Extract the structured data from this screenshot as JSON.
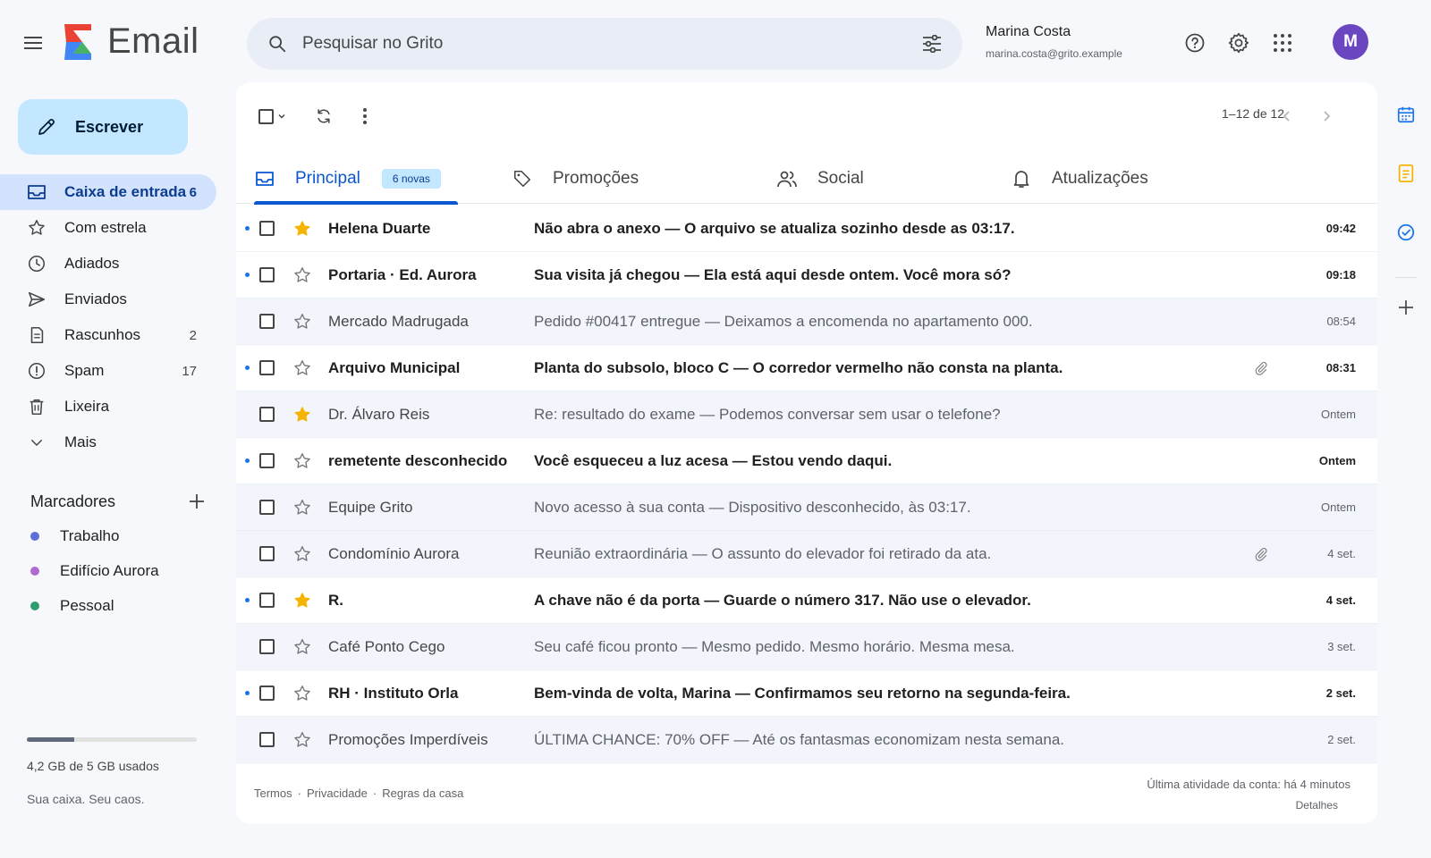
{
  "app": {
    "logo_text": "Email"
  },
  "search": {
    "placeholder": "Pesquisar no Grito"
  },
  "account": {
    "name": "Marina Costa",
    "email": "marina.costa@grito.example",
    "avatar_letter": "M",
    "avatar_color": "#6b46c1"
  },
  "compose": {
    "label": "Escrever"
  },
  "nav": [
    {
      "label": "Caixa de entrada",
      "count": "6",
      "icon": "inbox-icon",
      "active": true
    },
    {
      "label": "Com estrela",
      "count": "",
      "icon": "star-icon"
    },
    {
      "label": "Adiados",
      "count": "",
      "icon": "clock-icon"
    },
    {
      "label": "Enviados",
      "count": "",
      "icon": "send-icon"
    },
    {
      "label": "Rascunhos",
      "count": "2",
      "icon": "draft-icon"
    },
    {
      "label": "Spam",
      "count": "17",
      "icon": "spam-icon"
    },
    {
      "label": "Lixeira",
      "count": "",
      "icon": "trash-icon"
    },
    {
      "label": "Mais",
      "count": "",
      "icon": "chevron-down-icon"
    }
  ],
  "labels": {
    "title": "Marcadores",
    "items": [
      {
        "name": "Trabalho",
        "color": "#5b6fd6"
      },
      {
        "name": "Edifício Aurora",
        "color": "#b06ad0"
      },
      {
        "name": "Pessoal",
        "color": "#2e9e6e"
      }
    ]
  },
  "storage": {
    "text": "4,2 GB de 5 GB usados",
    "fraction": 0.28
  },
  "tagline": "Sua caixa. Seu caos.",
  "toolbar": {
    "pager": "1–12 de 12"
  },
  "tabs": [
    {
      "label": "Principal",
      "badge": "6 novas",
      "icon": "inbox-icon",
      "active": true
    },
    {
      "label": "Promoções",
      "icon": "tag-icon"
    },
    {
      "label": "Social",
      "icon": "people-icon"
    },
    {
      "label": "Atualizações",
      "icon": "bell-icon"
    }
  ],
  "emails": [
    {
      "sender": "Helena Duarte",
      "subject": "Não abra o anexo — O arquivo se atualiza sozinho desde as 03:17.",
      "time": "09:42",
      "unread": true,
      "starred": true,
      "attachment": false
    },
    {
      "sender": "Portaria · Ed. Aurora",
      "subject": "Sua visita já chegou — Ela está aqui desde ontem. Você mora só?",
      "time": "09:18",
      "unread": true,
      "starred": false,
      "attachment": false
    },
    {
      "sender": "Mercado Madrugada",
      "subject": "Pedido #00417 entregue — Deixamos a encomenda no apartamento 000.",
      "time": "08:54",
      "unread": false,
      "starred": false,
      "attachment": false
    },
    {
      "sender": "Arquivo Municipal",
      "subject": "Planta do subsolo, bloco C — O corredor vermelho não consta na planta.",
      "time": "08:31",
      "unread": true,
      "starred": false,
      "attachment": true
    },
    {
      "sender": "Dr. Álvaro Reis",
      "subject": "Re: resultado do exame — Podemos conversar sem usar o telefone?",
      "time": "Ontem",
      "unread": false,
      "starred": true,
      "attachment": false
    },
    {
      "sender": "remetente desconhecido",
      "subject": "Você esqueceu a luz acesa — Estou vendo daqui.",
      "time": "Ontem",
      "unread": true,
      "starred": false,
      "attachment": false
    },
    {
      "sender": "Equipe Grito",
      "subject": "Novo acesso à sua conta — Dispositivo desconhecido, às 03:17.",
      "time": "Ontem",
      "unread": false,
      "starred": false,
      "attachment": false
    },
    {
      "sender": "Condomínio Aurora",
      "subject": "Reunião extraordinária — O assunto do elevador foi retirado da ata.",
      "time": "4 set.",
      "unread": false,
      "starred": false,
      "attachment": true
    },
    {
      "sender": "R.",
      "subject": "A chave não é da porta — Guarde o número 317. Não use o elevador.",
      "time": "4 set.",
      "unread": true,
      "starred": true,
      "attachment": false
    },
    {
      "sender": "Café Ponto Cego",
      "subject": "Seu café ficou pronto — Mesmo pedido. Mesmo horário. Mesma mesa.",
      "time": "3 set.",
      "unread": false,
      "starred": false,
      "attachment": false
    },
    {
      "sender": "RH · Instituto Orla",
      "subject": "Bem-vinda de volta, Marina — Confirmamos seu retorno na segunda-feira.",
      "time": "2 set.",
      "unread": true,
      "starred": false,
      "attachment": false
    },
    {
      "sender": "Promoções Imperdíveis",
      "subject": "ÚLTIMA CHANCE: 70% OFF — Até os fantasmas economizam nesta semana.",
      "time": "2 set.",
      "unread": false,
      "starred": false,
      "attachment": false
    }
  ],
  "footer": {
    "links": [
      "Termos",
      "Privacidade",
      "Regras da casa"
    ],
    "activity": "Última atividade da conta: há 4 minutos",
    "details": "Detalhes"
  },
  "colors": {
    "accent": "#0b57d0",
    "star": "#f4b400",
    "compose_bg": "#c2e7ff",
    "active_nav_bg": "#d3e3fd"
  }
}
